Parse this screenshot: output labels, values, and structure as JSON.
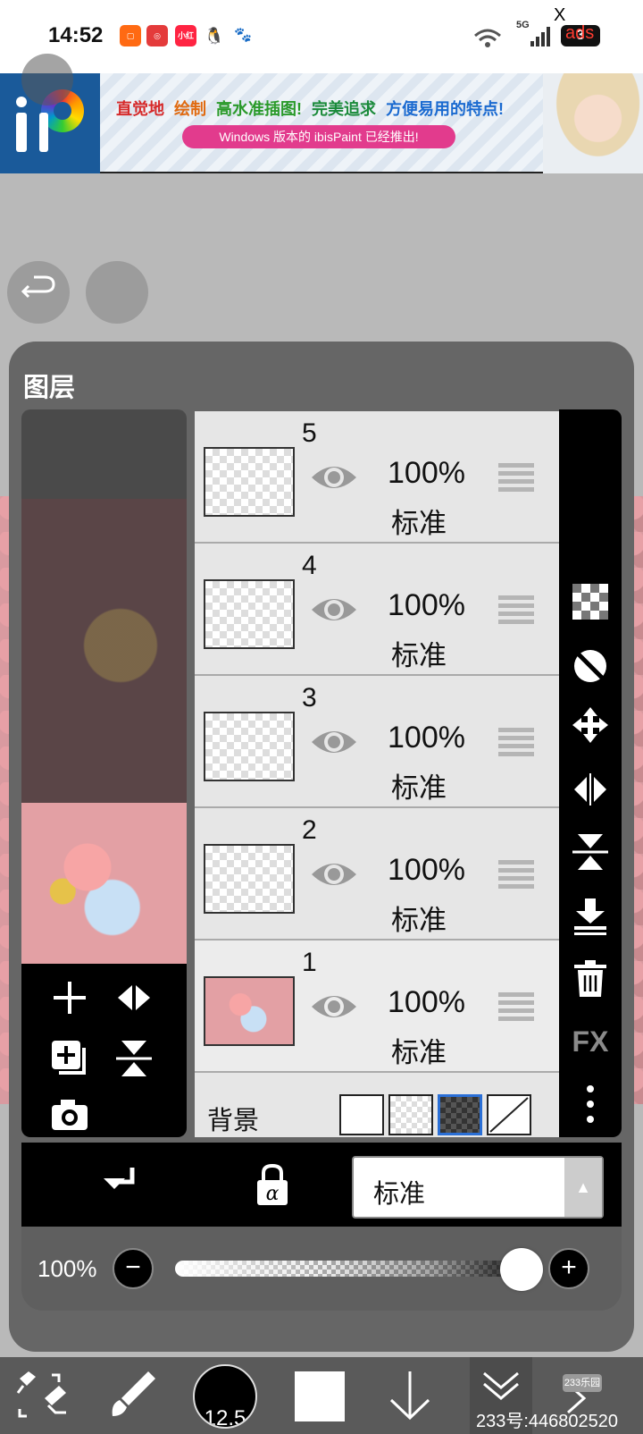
{
  "status_bar": {
    "time": "14:52",
    "app_icons": [
      {
        "icon": "orange-square-icon",
        "color": "#ff6a13"
      },
      {
        "icon": "netease-news-icon",
        "color": "#e43b3b"
      },
      {
        "icon": "xiaohongshu-icon",
        "label": "小红书",
        "color": "#ff2442"
      },
      {
        "icon": "qq-penguin-icon",
        "color": "#222222"
      },
      {
        "icon": "baidu-icon",
        "color": "#2a5bd8"
      }
    ],
    "network": "5G",
    "battery": "3"
  },
  "ad_overlay": {
    "close": "X",
    "label": "ads"
  },
  "banner": {
    "headline": [
      "直觉地",
      "绘制",
      "高水准插图!",
      "完美追求",
      "方便易用的特点!"
    ],
    "headline_colors": [
      "#d62a2a",
      "#e06a10",
      "#2a9a2a",
      "#1a8a3a",
      "#1a6ad0"
    ],
    "subline": "Windows 版本的 ibisPaint 已经推出!"
  },
  "layer_panel": {
    "title": "图层",
    "layers": [
      {
        "number": "5",
        "opacity": "100%",
        "blend": "标准",
        "thumbnail": "empty"
      },
      {
        "number": "4",
        "opacity": "100%",
        "blend": "标准",
        "thumbnail": "empty"
      },
      {
        "number": "3",
        "opacity": "100%",
        "blend": "标准",
        "thumbnail": "empty"
      },
      {
        "number": "2",
        "opacity": "100%",
        "blend": "标准",
        "thumbnail": "empty"
      },
      {
        "number": "1",
        "opacity": "100%",
        "blend": "标准",
        "thumbnail": "picture"
      }
    ],
    "background_label": "背景",
    "background_options": [
      "white",
      "transparent",
      "dark-checker",
      "none"
    ],
    "background_selected": "dark-checker",
    "right_toolbar": [
      "checker-icon",
      "invert-circle-icon",
      "move-icon",
      "flip-horizontal-icon",
      "flip-vertical-icon",
      "merge-down-icon",
      "trash-icon",
      "fx-icon",
      "more-icon"
    ],
    "fx_label": "FX",
    "blend_mode": "标准",
    "opacity_label": "100%",
    "opacity_fraction": 1.0
  },
  "bottom_toolbar": {
    "brush_size": "12.5",
    "color": "#ffffff"
  },
  "watermark": {
    "badge": "233乐园",
    "text": "233号:446802520"
  }
}
